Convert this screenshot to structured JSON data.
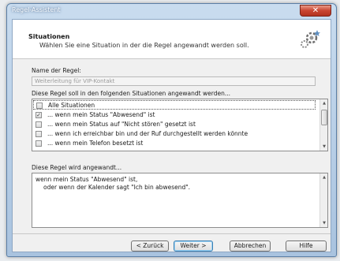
{
  "window": {
    "title": "Regel-Assistent",
    "close_glyph": "✕"
  },
  "header": {
    "title": "Situationen",
    "subtitle": "Wählen Sie eine Situation in der die Regel angewandt werden soll.",
    "icon": "wizard-gear-icon"
  },
  "rule_name": {
    "label": "Name der Regel:",
    "value": "Weiterleitung für VIP-Kontakt"
  },
  "situations": {
    "label": "Diese Regel soll in den folgenden Situationen angewandt werden...",
    "items": [
      {
        "label": "Alle Situationen",
        "checked": false,
        "mark": ""
      },
      {
        "label": "... wenn mein Status \"Abwesend\" ist",
        "checked": true,
        "mark": "✓"
      },
      {
        "label": "... wenn mein Status auf \"Nicht stören\" gesetzt ist",
        "checked": false,
        "mark": ""
      },
      {
        "label": "... wenn ich erreichbar bin und der Ruf durchgestellt werden könnte",
        "checked": false,
        "mark": ""
      },
      {
        "label": "... wenn mein Telefon besetzt ist",
        "checked": false,
        "mark": ""
      }
    ],
    "scroll_up": "▲",
    "scroll_down": "▼"
  },
  "description": {
    "label": "Diese Regel wird angewandt...",
    "line1": "wenn mein Status \"Abwesend\" ist,",
    "line2": "oder wenn der Kalender sagt \"Ich bin abwesend\".",
    "scroll_up": "▲",
    "scroll_down": "▼"
  },
  "buttons": {
    "back": "< Zurück",
    "next": "Weiter >",
    "cancel": "Abbrechen",
    "help": "Hilfe"
  },
  "colors": {
    "accent": "#3c7fb1",
    "title_bar": "#a9c3df",
    "close": "#c94531"
  }
}
